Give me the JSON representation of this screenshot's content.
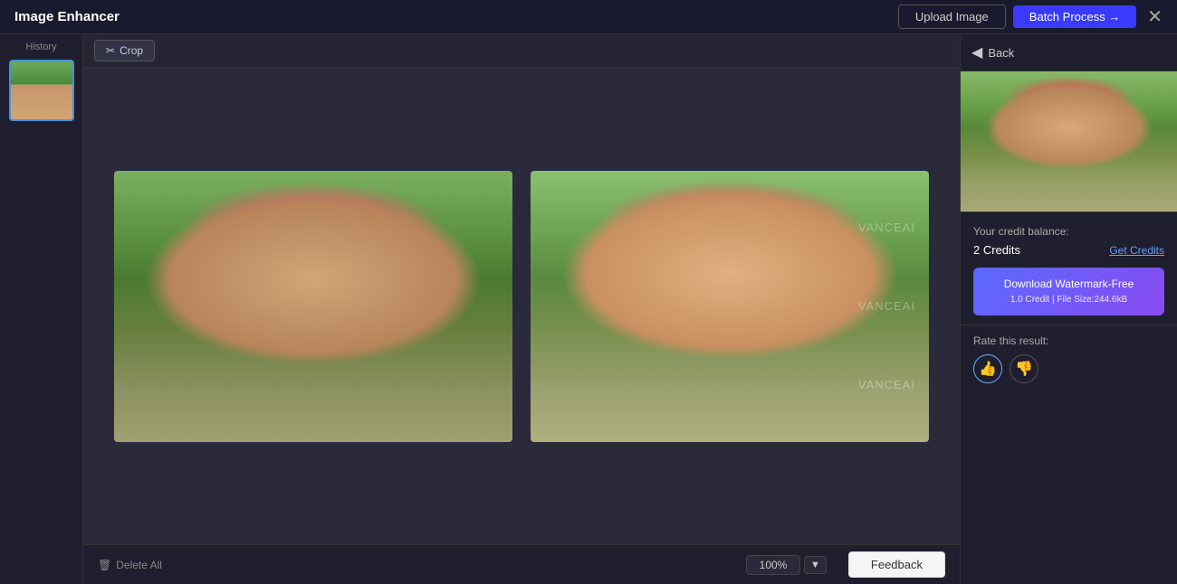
{
  "header": {
    "title": "Image Enhancer",
    "upload_label": "Upload Image",
    "batch_label": "Batch Process →",
    "close_icon": "✕"
  },
  "sidebar": {
    "label": "History"
  },
  "toolbar": {
    "crop_icon": "✂",
    "crop_label": "Crop"
  },
  "canvas": {
    "image_left_alt": "Original portrait",
    "image_right_alt": "Enhanced portrait",
    "watermark_text": "VANCEAI"
  },
  "bottom": {
    "delete_icon": "🗑",
    "delete_label": "Delete All",
    "zoom_value": "100%",
    "feedback_label": "Feedback"
  },
  "right_panel": {
    "back_label": "Back",
    "credit_balance_label": "Your credit balance:",
    "credit_value": "2 Credits",
    "get_credits_label": "Get Credits",
    "download_label": "Download Watermark-Free",
    "download_sub": "1.0 Credit | File Size:244.6kB",
    "rate_label": "Rate this result:",
    "thumb_up": "👍",
    "thumb_down": "👎"
  }
}
